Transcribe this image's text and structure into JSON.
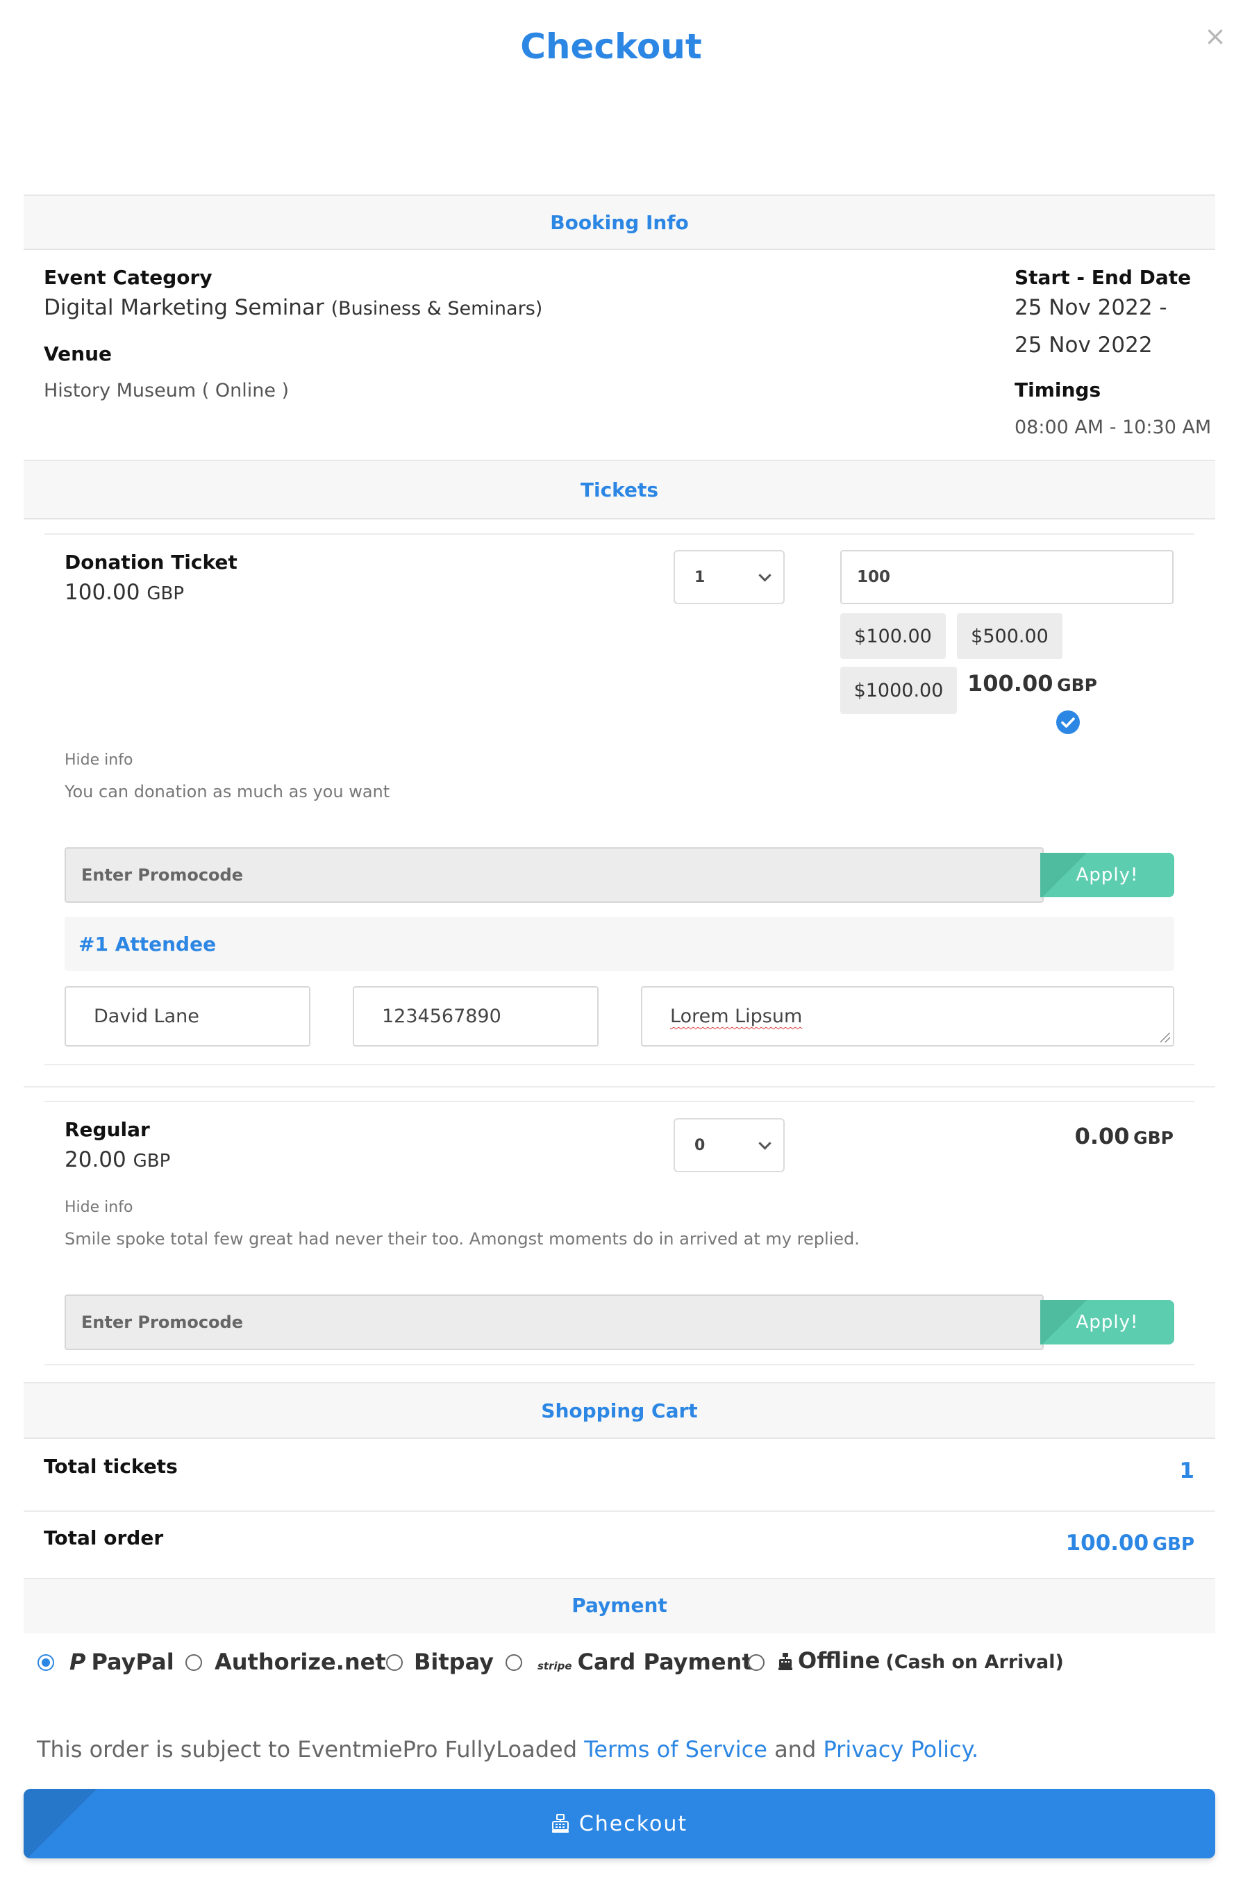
{
  "header": {
    "title": "Checkout",
    "close": "×"
  },
  "booking": {
    "section_title": "Booking Info",
    "category_label": "Event Category",
    "event_name": "Digital Marketing Seminar",
    "event_category": "(Business & Seminars)",
    "venue_label": "Venue",
    "venue": "History Museum ( Online )",
    "date_label": "Start - End Date",
    "start_date": "25 Nov 2022 -",
    "end_date": "25 Nov 2022",
    "timings_label": "Timings",
    "timings": "08:00 AM - 10:30 AM"
  },
  "tickets": {
    "section_title": "Tickets",
    "donation": {
      "name": "Donation Ticket",
      "price": "100.00",
      "currency": "GBP",
      "qty": "1",
      "amount_value": "100",
      "amounts": [
        "$100.00",
        "$500.00",
        "$1000.00"
      ],
      "total": "100.00",
      "total_currency": "GBP",
      "hide_info": "Hide info",
      "description": "You can donation as much as you want",
      "promo_placeholder": "Enter Promocode",
      "apply_label": "Apply!",
      "attendee_title": "#1 Attendee",
      "attendee_name": "David Lane",
      "attendee_phone": "1234567890",
      "attendee_address": "Lorem Lipsum"
    },
    "regular": {
      "name": "Regular",
      "price": "20.00",
      "currency": "GBP",
      "qty": "0",
      "total": "0.00",
      "total_currency": "GBP",
      "hide_info": "Hide info",
      "description": "Smile spoke total few great had never their too. Amongst moments do in arrived at my replied.",
      "promo_placeholder": "Enter Promocode",
      "apply_label": "Apply!"
    }
  },
  "cart": {
    "section_title": "Shopping Cart",
    "total_tickets_label": "Total tickets",
    "total_tickets": "1",
    "total_order_label": "Total order",
    "total_order": "100.00",
    "total_order_currency": "GBP"
  },
  "payment": {
    "section_title": "Payment",
    "options": [
      {
        "label": "PayPal",
        "selected": true
      },
      {
        "label": "Authorize.net",
        "selected": false
      },
      {
        "label": "Bitpay",
        "selected": false
      },
      {
        "label": "Card Payment",
        "prefix": "stripe",
        "selected": false
      },
      {
        "label": "Offline",
        "sub": "(Cash on Arrival)",
        "selected": false
      }
    ]
  },
  "terms": {
    "prefix": "This order is subject to EventmiePro FullyLoaded",
    "tos": "Terms of Service",
    "and": "and",
    "privacy": "Privacy Policy."
  },
  "checkout_button": "Checkout",
  "colors": {
    "primary": "#2c86e3",
    "apply": "#5dcdb0"
  }
}
